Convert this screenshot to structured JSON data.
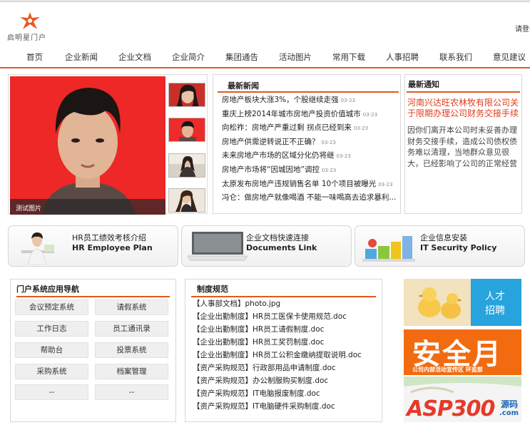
{
  "header": {
    "logo_text": "启明星门户",
    "login_text": "请登录"
  },
  "nav": {
    "items": [
      "首页",
      "企业新闻",
      "企业文档",
      "企业简介",
      "集团通告",
      "活动图片",
      "常用下载",
      "人事招聘",
      "联系我们",
      "意见建议"
    ]
  },
  "hero": {
    "caption": "测试图片"
  },
  "latest_news": {
    "title": "最新新闻",
    "items": [
      {
        "text": "房地产板块大涨3%，个股继续走强",
        "date": "03-23"
      },
      {
        "text": "重庆上榜2014年城市房地产投资价值城市",
        "date": "03-23"
      },
      {
        "text": "向松祚：房地产严重过剩 拐点已经到来",
        "date": "03-23"
      },
      {
        "text": "房地产供需逆转说正不正确？",
        "date": "03-23"
      },
      {
        "text": "未来房地产市场的区域分化仍将继",
        "date": "03-23"
      },
      {
        "text": "房地产市场将“因城因地”调控",
        "date": "03-23"
      },
      {
        "text": "太原发布房地产违规销售名单 10个项目被曝光",
        "date": "03-23"
      },
      {
        "text": "冯仑：做房地产就像喝酒 不能一味喝高去追求暴利...",
        "date": ""
      }
    ]
  },
  "notice": {
    "title": "最新通知",
    "headline": "河南兴达旺农林牧有限公司关于限期办理公司财务交接手续",
    "body": "因你们离开本公司时未妥善办理财务交接手续，造成公司债权债务难以清理，当地群众意见很大，已经影响了公司的正常经营"
  },
  "features": [
    {
      "line1": "HR员工绩效考核介绍",
      "line2": "HR Employee Plan"
    },
    {
      "line1": "企业文档快速连接",
      "line2": "Documents Link"
    },
    {
      "line1": "企业信息安装",
      "line2": "IT Security Policy"
    }
  ],
  "app_nav": {
    "title": "门户系统应用导航",
    "buttons": [
      "会议预定系统",
      "请假系统",
      "工作日志",
      "员工通讯录",
      "帮助台",
      "投票系统",
      "采购系统",
      "档案管理",
      "--",
      "--"
    ]
  },
  "regulations": {
    "title": "制度规范",
    "items": [
      "【人事部文档】photo.jpg",
      "【企业出勤制度】HR员工医保卡使用规范.doc",
      "【企业出勤制度】HR员工请假制度.doc",
      "【企业出勤制度】HR员工奖罚制度.doc",
      "【企业出勤制度】HR员工公积金缴纳提取说明.doc",
      "【资产采购规范】行政部用品申请制度.doc",
      "【资产采购规范】办公制服购买制度.doc",
      "【资产采购规范】IT电脑报废制度.doc",
      "【资产采购规范】IT电脑硬件采购制度.doc"
    ]
  },
  "ads": {
    "recruit_line1": "人才",
    "recruit_line2": "招聘",
    "safety_big": "安全月",
    "safety_sub": "公司内部活动宣传区  环监部",
    "watermark": "ASP300",
    "watermark_cn": "源码",
    "watermark_domain": ".com"
  },
  "colors": {
    "accent": "#e05a1b",
    "notice_red": "#e13b1b",
    "safety_orange": "#f26b10",
    "recruit_blue": "#27a3dd"
  }
}
